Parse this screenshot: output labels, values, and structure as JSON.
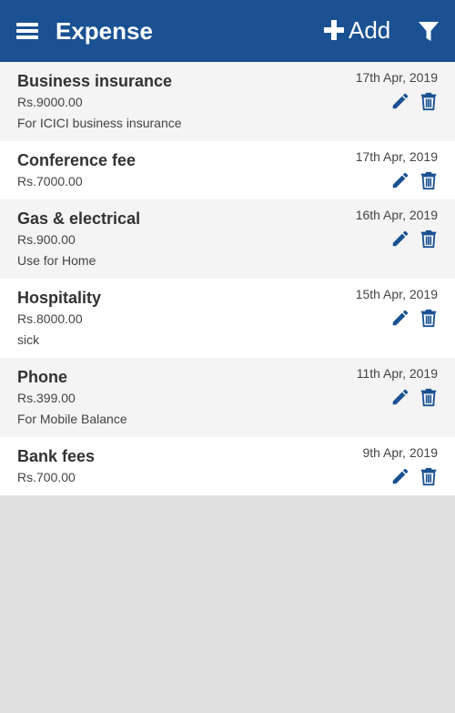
{
  "header": {
    "title": "Expense",
    "add_label": "Add"
  },
  "expenses": [
    {
      "name": "Business insurance",
      "amount": "Rs.9000.00",
      "note": "For ICICI business insurance",
      "date": "17th Apr, 2019"
    },
    {
      "name": "Conference fee",
      "amount": "Rs.7000.00",
      "note": "",
      "date": "17th Apr, 2019"
    },
    {
      "name": "Gas & electrical",
      "amount": "Rs.900.00",
      "note": "Use for Home",
      "date": "16th Apr, 2019"
    },
    {
      "name": "Hospitality",
      "amount": "Rs.8000.00",
      "note": "sick",
      "date": "15th Apr, 2019"
    },
    {
      "name": "Phone",
      "amount": "Rs.399.00",
      "note": "For Mobile Balance",
      "date": "11th Apr, 2019"
    },
    {
      "name": "Bank fees",
      "amount": "Rs.700.00",
      "note": "",
      "date": "9th Apr, 2019"
    }
  ],
  "colors": {
    "appbar": "#1a5192",
    "icon": "#1a5192",
    "odd_row": "#f4f4f4",
    "even_row": "#ffffff",
    "background": "#e0e0e0"
  },
  "icons": {
    "menu": "menu-icon",
    "add": "plus-icon",
    "filter": "filter-icon",
    "edit": "pencil-icon",
    "delete": "trash-icon"
  }
}
